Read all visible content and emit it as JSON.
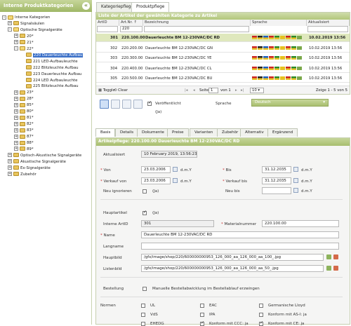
{
  "left": {
    "title": "Interne Produktkategorien",
    "collapse": "«",
    "tree": [
      {
        "label": "Interne Kategorien",
        "depth": 0,
        "toggle": "–",
        "open": true
      },
      {
        "label": "Signalsäulen",
        "depth": 1,
        "toggle": "+"
      },
      {
        "label": "Optische Signalgeräte",
        "depth": 1,
        "toggle": "–",
        "open": true
      },
      {
        "label": "20*",
        "depth": 2,
        "toggle": "+"
      },
      {
        "label": "21*",
        "depth": 2,
        "toggle": "+"
      },
      {
        "label": "22*",
        "depth": 2,
        "toggle": "–",
        "open": true
      },
      {
        "label": "220 Dauerleuchte Aufbau",
        "depth": 3,
        "selected": true
      },
      {
        "label": "221 LED-Aufbauleuchte",
        "depth": 3
      },
      {
        "label": "222 Blitzleuchte Aufbau",
        "depth": 3
      },
      {
        "label": "223 Dauerleuchte Aufbau",
        "depth": 3
      },
      {
        "label": "224 LED Aufbauleuchte",
        "depth": 3
      },
      {
        "label": "225 Blitzleuchte Aufbau",
        "depth": 3
      },
      {
        "label": "23*",
        "depth": 2,
        "toggle": "+"
      },
      {
        "label": "28*",
        "depth": 2,
        "toggle": "+"
      },
      {
        "label": "85*",
        "depth": 2,
        "toggle": "+"
      },
      {
        "label": "80*",
        "depth": 2,
        "toggle": "+"
      },
      {
        "label": "81*",
        "depth": 2,
        "toggle": "+"
      },
      {
        "label": "82*",
        "depth": 2,
        "toggle": "+"
      },
      {
        "label": "83*",
        "depth": 2,
        "toggle": "+"
      },
      {
        "label": "87*",
        "depth": 2,
        "toggle": "+"
      },
      {
        "label": "88*",
        "depth": 2,
        "toggle": "+"
      },
      {
        "label": "89*",
        "depth": 2,
        "toggle": "+"
      },
      {
        "label": "Optisch-Akustische Signalgeräte",
        "depth": 1,
        "toggle": "+"
      },
      {
        "label": "Akustische Signalgeräte",
        "depth": 1,
        "toggle": "+"
      },
      {
        "label": "Ex-Signalgeräte",
        "depth": 1,
        "toggle": "+"
      },
      {
        "label": "Zubehör",
        "depth": 1,
        "toggle": "+"
      }
    ]
  },
  "top_tabs": [
    "Kategoriepflege",
    "Produktpflege"
  ],
  "grid": {
    "title": "Liste der Artikel der gewählten Kategorie zu Artikel",
    "headers": [
      "ArtID",
      "Art.Nr. ↑",
      "Bezeichnung",
      "Sprache",
      "Aktualisiert"
    ],
    "filter_artnr": "220",
    "rows": [
      {
        "id": "301",
        "artnr": "220.100.00",
        "name": "Dauerleuchte BM 12-230VAC/DC RD",
        "date": "10.02.2019 13:56"
      },
      {
        "id": "302",
        "artnr": "220.200.00",
        "name": "Dauerleuchte BM 12-230VAC/DC GN",
        "date": "10.02.2019 13:56"
      },
      {
        "id": "303",
        "artnr": "220.300.00",
        "name": "Dauerleuchte BM 12-230VAC/DC YE",
        "date": "10.02.2019 13:56"
      },
      {
        "id": "304",
        "artnr": "220.400.00",
        "name": "Dauerleuchte BM 12-230VAC/DC CL",
        "date": "10.02.2019 13:56"
      },
      {
        "id": "305",
        "artnr": "220.500.00",
        "name": "Dauerleuchte BM 12-230VAC/DC BU",
        "date": "10.02.2019 13:56"
      }
    ],
    "pager": {
      "toggle": "Toggle",
      "clear": "Clear",
      "page_label": "Seite",
      "page": "1",
      "of": "von 1",
      "per_page": "10",
      "summary": "Zeige 1 - 5 von 5"
    }
  },
  "toolbar": {
    "published_label": "Veröffentlicht",
    "published_value": "(Ja)",
    "language_label": "Sprache",
    "language_value": "Deutsch"
  },
  "detail_tabs": [
    "Basis",
    "Details",
    "Dokumente",
    "Preise",
    "Varianten",
    "Zubehör",
    "Alternativ",
    "Ergänzend"
  ],
  "detail": {
    "title": "Artikelpflege: 220.100.00 Dauerleuchte BM 12-230VAC/DC RD",
    "updated_label": "Aktualisiert",
    "updated_value": "10 February 2019, 13:56:23",
    "von_label": "Von",
    "von_value": "23.03.2006",
    "fmt": "d.m.Y",
    "bis_label": "Bis",
    "bis_value": "31.12.2035",
    "vk_von_label": "Verkauf von",
    "vk_von_value": "23.03.2006",
    "vk_bis_label": "Verkauf bis",
    "vk_bis_value": "31.12.2035",
    "neu_ign_label": "Neu ignorieren",
    "neu_ign_value": "(Ja)",
    "neu_bis_label": "Neu bis",
    "haupt_label": "Hauptartikel",
    "haupt_value": "(Ja)",
    "intern_label": "Interne ArtID",
    "intern_value": "301",
    "matnr_label": "Materialnummer",
    "matnr_value": "220.100.00",
    "name_label": "Name",
    "name_value": "Dauerleuchte BM 12-230VAC/DC RD",
    "lang_label": "Langname",
    "hauptbild_label": "Hauptbild",
    "hauptbild_value": "/gfx/image/shop/220/600000000953_126_000_aa_126_000_aa_100_.jpg",
    "listbild_label": "Listenbild",
    "listbild_value": "/gfx/image/shop/220/600000000953_126_000_aa_126_000_aa_50_.jpg",
    "bestell_label": "Bestellung",
    "bestell_value": "Manuelle Bestellabwicklung im Bestellablauf erzwingen",
    "normen_label": "Normen",
    "normen": [
      {
        "label": "UL",
        "on": false
      },
      {
        "label": "EAC",
        "on": false
      },
      {
        "label": "Germanische Lloyd",
        "on": false
      },
      {
        "label": "VdS",
        "on": false
      },
      {
        "label": "IPA",
        "on": false
      },
      {
        "label": "Konform mit AS-I: ja",
        "on": false
      },
      {
        "label": "EHEDG",
        "on": false
      },
      {
        "label": "Konform mit CCC: ja",
        "on": true
      },
      {
        "label": "Konform mit CE: ja",
        "on": true
      }
    ]
  }
}
